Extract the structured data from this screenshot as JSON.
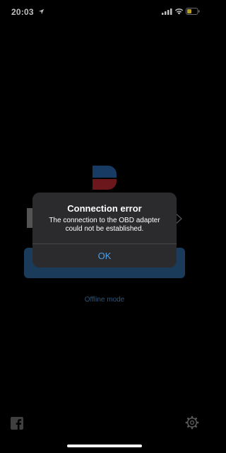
{
  "status_bar": {
    "time": "20:03",
    "icons": [
      "location-arrow-icon",
      "signal-icon",
      "wifi-icon",
      "battery-icon"
    ]
  },
  "background": {
    "offline_link": "Offline mode",
    "button_color": "#234f79",
    "link_color": "#3f6f9d",
    "bottom_icons": [
      "facebook-icon",
      "settings-icon"
    ]
  },
  "alert": {
    "title": "Connection error",
    "message_line1": "The connection to the OBD adapter",
    "message_line2": "could not be established.",
    "ok_label": "OK",
    "ok_color": "#4a9fe8"
  }
}
